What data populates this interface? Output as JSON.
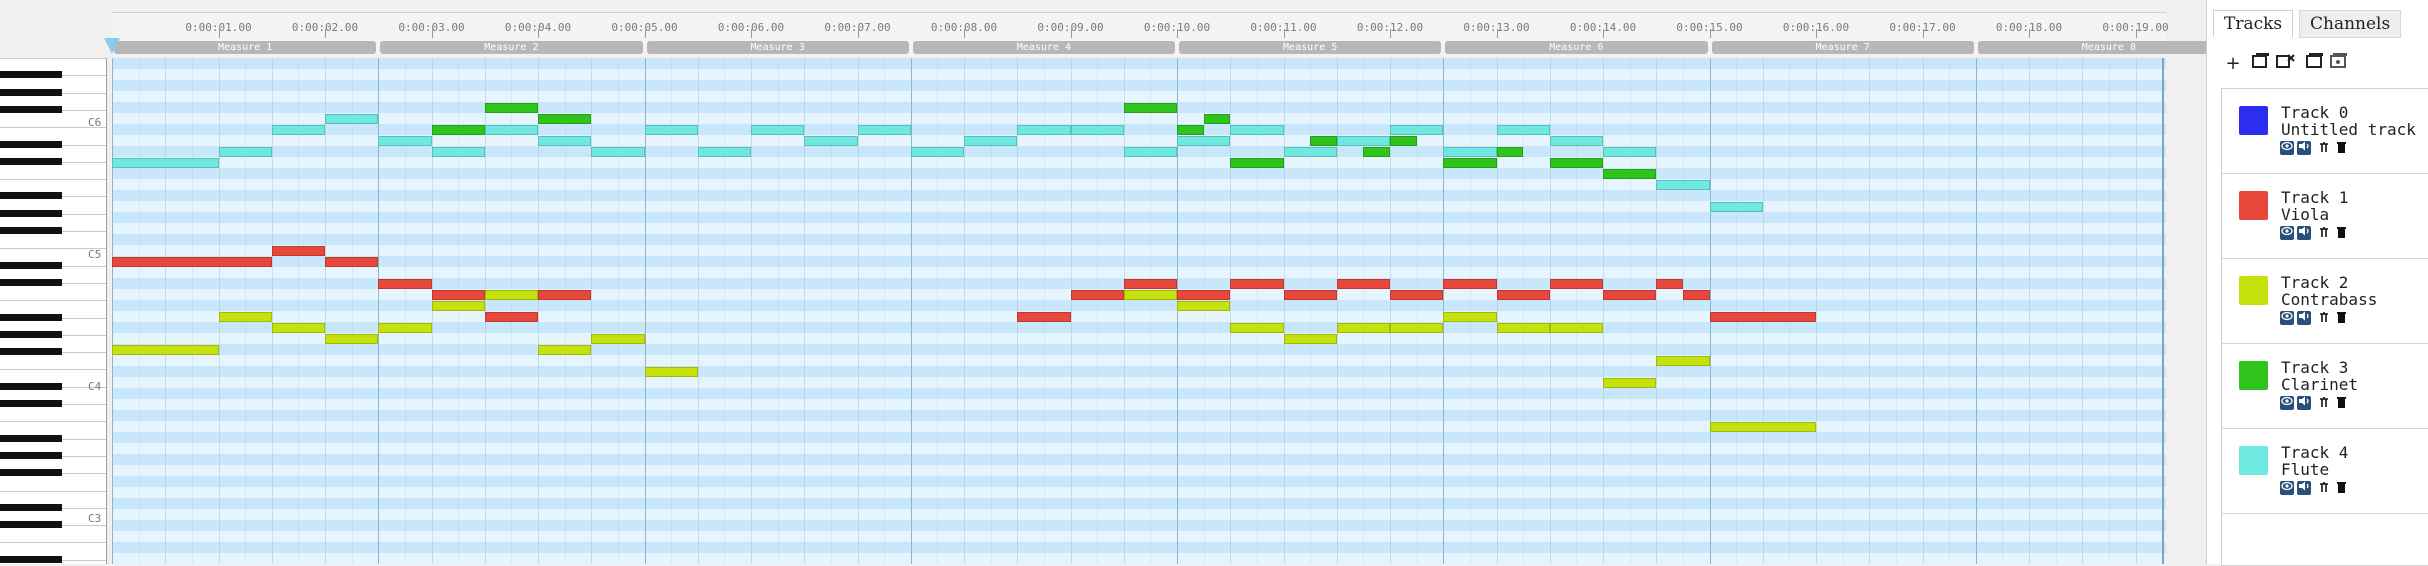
{
  "ruler": {
    "time_labels": [
      "0:00:01.00",
      "0:00:02.00",
      "0:00:03.00",
      "0:00:04.00",
      "0:00:05.00",
      "0:00:06.00",
      "0:00:07.00",
      "0:00:08.00",
      "0:00:09.00",
      "0:00:10.00",
      "0:00:11.00",
      "0:00:12.00",
      "0:00:13.00",
      "0:00:14.00",
      "0:00:15.00",
      "0:00:16.00",
      "0:00:17.00",
      "0:00:18.00",
      "0:00:19.00"
    ],
    "measures": [
      "Measure 1",
      "Measure 2",
      "Measure 3",
      "Measure 4",
      "Measure 5",
      "Measure 6",
      "Measure 7",
      "Measure 8"
    ]
  },
  "piano": {
    "octave_labels": [
      "C6",
      "C5",
      "C4",
      "C3"
    ]
  },
  "panel": {
    "tabs": [
      "Tracks",
      "Channels"
    ],
    "active_tab": "Tracks",
    "toolbar_icons": [
      "add-track-icon",
      "import-track-icon",
      "mute-all-icon",
      "solo-icon",
      "hide-all-icon"
    ],
    "add_label": "+",
    "tracks": [
      {
        "line1": "Track 0",
        "line2": "Untitled track",
        "color": "#2d2df0"
      },
      {
        "line1": "Track 1",
        "line2": "Viola",
        "color": "#e8473c"
      },
      {
        "line1": "Track 2",
        "line2": "Contrabass",
        "color": "#c6e20d"
      },
      {
        "line1": "Track 3",
        "line2": "Clarinet",
        "color": "#2fc41c"
      },
      {
        "line1": "Track 4",
        "line2": "Flute",
        "color": "#6fe8e0"
      }
    ]
  },
  "notes": {
    "Viola": [
      [
        0,
        1.5,
        27
      ],
      [
        1.5,
        2,
        28
      ],
      [
        2,
        2.5,
        27
      ],
      [
        2.5,
        3,
        25
      ],
      [
        3,
        3.5,
        24
      ],
      [
        3.5,
        4,
        22
      ],
      [
        4,
        4.5,
        24
      ],
      [
        8.5,
        9,
        22
      ],
      [
        9,
        9.5,
        24
      ],
      [
        9.5,
        10,
        25
      ],
      [
        10,
        10.5,
        24
      ],
      [
        10.5,
        11,
        25
      ],
      [
        11,
        11.5,
        24
      ],
      [
        11.5,
        12,
        25
      ],
      [
        12,
        12.5,
        24
      ],
      [
        12.5,
        13,
        25
      ],
      [
        13,
        13.5,
        24
      ],
      [
        13.5,
        14,
        25
      ],
      [
        14,
        14.5,
        24
      ],
      [
        14.5,
        14.75,
        25
      ],
      [
        14.75,
        15,
        24
      ],
      [
        15,
        16,
        22
      ]
    ],
    "Contrabass": [
      [
        0,
        1,
        19
      ],
      [
        1,
        1.5,
        22
      ],
      [
        1.5,
        2,
        21
      ],
      [
        2,
        2.5,
        20
      ],
      [
        2.5,
        3,
        21
      ],
      [
        3,
        3.5,
        23
      ],
      [
        3.5,
        4,
        24
      ],
      [
        4,
        4.5,
        19
      ],
      [
        4.5,
        5,
        20
      ],
      [
        5,
        5.5,
        17
      ],
      [
        9.5,
        10,
        24
      ],
      [
        10,
        10.5,
        23
      ],
      [
        10.5,
        11,
        21
      ],
      [
        11,
        11.5,
        20
      ],
      [
        11.5,
        12,
        21
      ],
      [
        12,
        12.5,
        21
      ],
      [
        12.5,
        13,
        22
      ],
      [
        13,
        13.5,
        21
      ],
      [
        13.5,
        14,
        21
      ],
      [
        14,
        14.5,
        16
      ],
      [
        14.5,
        15,
        18
      ],
      [
        15,
        16,
        12
      ]
    ],
    "Clarinet": [
      [
        3,
        3.5,
        39
      ],
      [
        3.5,
        4,
        41
      ],
      [
        4,
        4.5,
        40
      ],
      [
        4,
        4.5,
        38
      ],
      [
        9.25,
        9.5,
        39
      ],
      [
        9.5,
        10,
        41
      ],
      [
        10,
        10.25,
        39
      ],
      [
        10.25,
        10.5,
        40
      ],
      [
        10.5,
        11,
        36
      ],
      [
        11,
        11.25,
        37
      ],
      [
        11.25,
        11.5,
        38
      ],
      [
        11.75,
        12,
        37
      ],
      [
        12,
        12.25,
        38
      ],
      [
        12.5,
        13,
        36
      ],
      [
        13,
        13.25,
        37
      ],
      [
        13.5,
        14,
        36
      ],
      [
        14,
        14.5,
        35
      ]
    ],
    "Flute": [
      [
        0,
        1,
        36
      ],
      [
        1,
        1.5,
        37
      ],
      [
        1.5,
        2,
        39
      ],
      [
        2,
        2.5,
        40
      ],
      [
        2.5,
        3,
        38
      ],
      [
        3,
        3.5,
        37
      ],
      [
        3.5,
        4,
        39
      ],
      [
        4,
        4.5,
        38
      ],
      [
        4.5,
        5,
        37
      ],
      [
        5,
        5.5,
        39
      ],
      [
        5.5,
        6,
        37
      ],
      [
        6,
        6.5,
        39
      ],
      [
        6.5,
        7,
        38
      ],
      [
        7,
        7.5,
        39
      ],
      [
        7.5,
        8,
        37
      ],
      [
        8,
        8.5,
        38
      ],
      [
        8.5,
        9,
        39
      ],
      [
        9,
        9.5,
        39
      ],
      [
        9.5,
        10,
        37
      ],
      [
        10,
        10.5,
        38
      ],
      [
        10.5,
        11,
        39
      ],
      [
        11,
        11.5,
        37
      ],
      [
        11.5,
        12,
        38
      ],
      [
        12,
        12.5,
        39
      ],
      [
        12.5,
        13,
        37
      ],
      [
        13,
        13.5,
        39
      ],
      [
        13.5,
        14,
        38
      ],
      [
        14,
        14.5,
        37
      ],
      [
        14.5,
        15,
        34
      ],
      [
        15,
        15.5,
        32
      ]
    ]
  }
}
